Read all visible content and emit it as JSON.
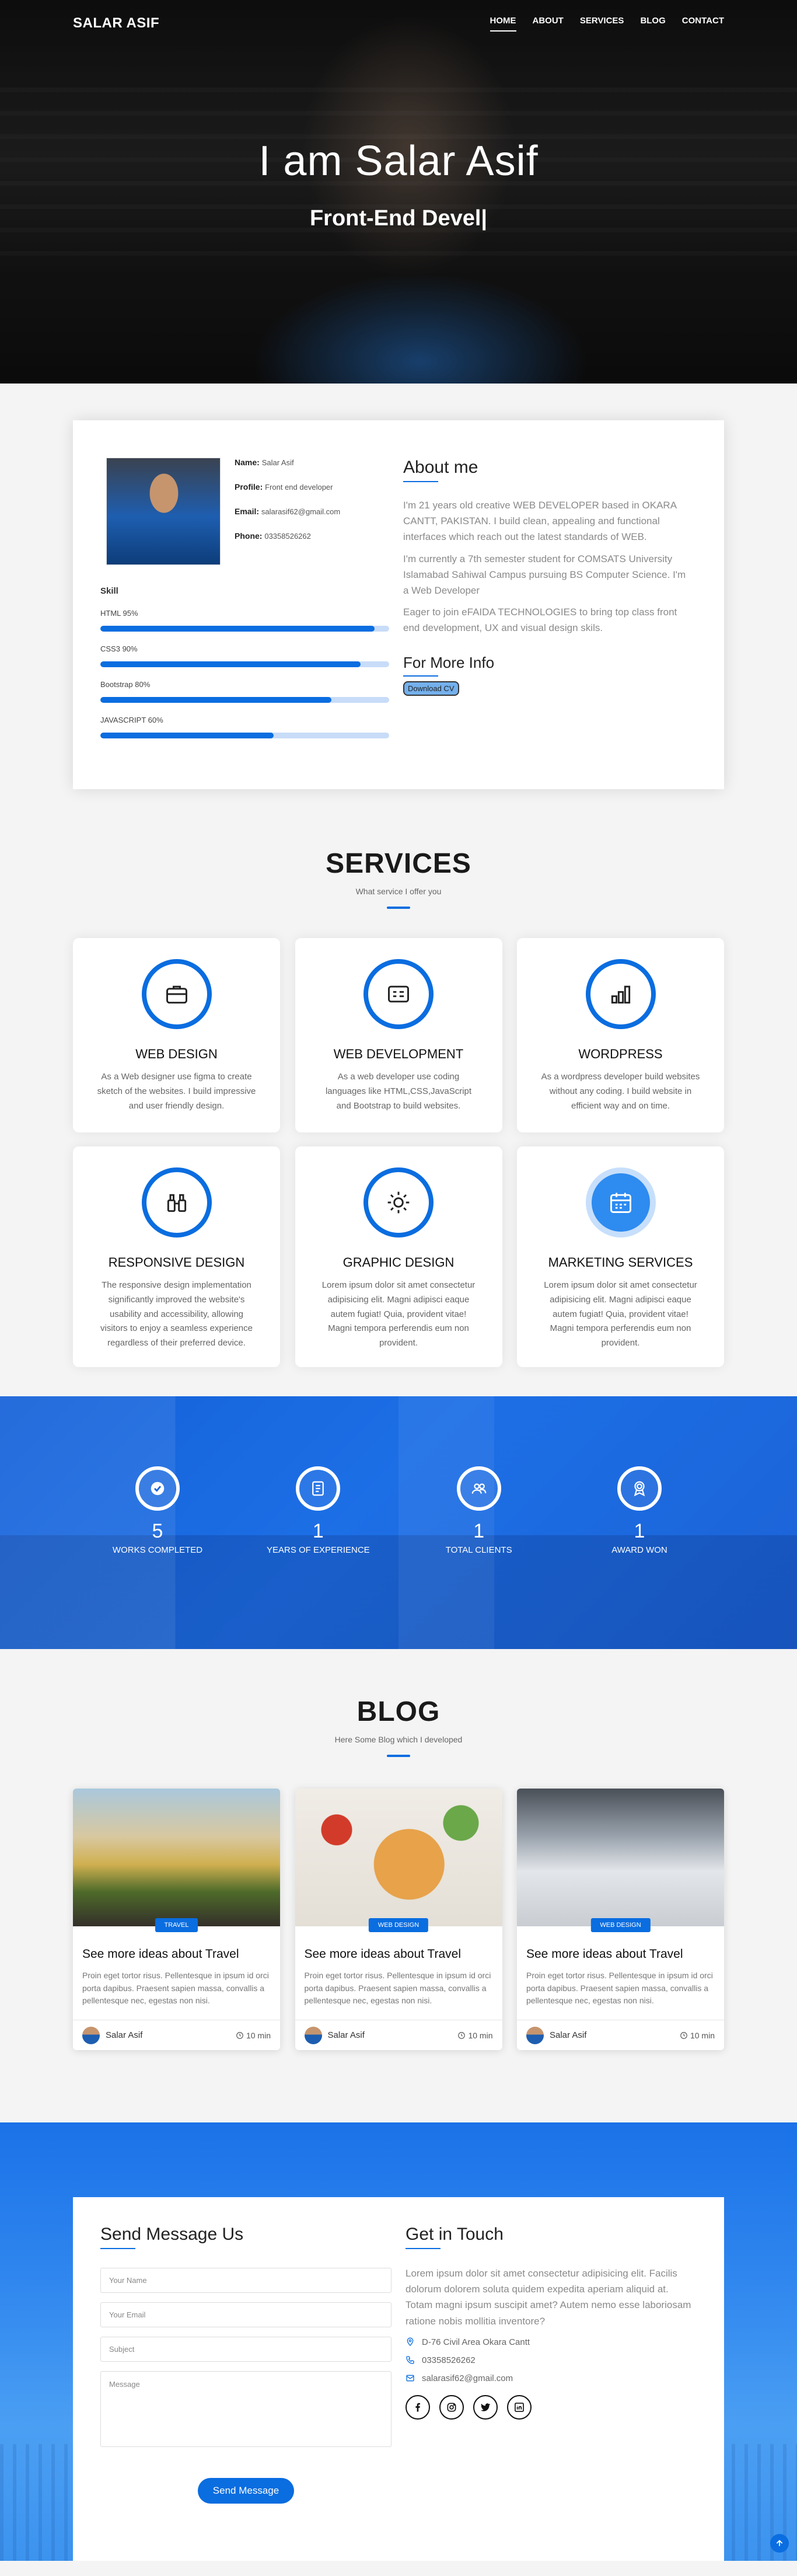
{
  "nav": {
    "logo": "SALAR ASIF",
    "items": [
      "HOME",
      "ABOUT",
      "SERVICES",
      "BLOG",
      "CONTACT"
    ]
  },
  "hero": {
    "title": "I am Salar Asif",
    "subtitle": "Front-End Devel|"
  },
  "about": {
    "name_label": "Name:",
    "name_value": "Salar Asif",
    "profile_label": "Profile:",
    "profile_value": "Front end developer",
    "email_label": "Email:",
    "email_value": "salarasif62@gmail.com",
    "phone_label": "Phone:",
    "phone_value": "03358526262",
    "skills_title": "Skill",
    "skills": [
      {
        "label": "HTML 95%",
        "percent": 95
      },
      {
        "label": "CSS3 90%",
        "percent": 90
      },
      {
        "label": "Bootstrap 80%",
        "percent": 80
      },
      {
        "label": "JAVASCRIPT 60%",
        "percent": 60
      }
    ],
    "heading": "About me",
    "p1": "I'm 21 years old creative WEB DEVELOPER based in OKARA CANTT, PAKISTAN. I build clean, appealing and functional interfaces which reach out the latest standards of WEB.",
    "p2": "I'm currently a 7th semester student for COMSATS University Islamabad Sahiwal Campus pursuing BS Computer Science. I'm a Web Developer",
    "p3": "Eager to join eFAIDA TECHNOLOGIES to bring top class front end development, UX and visual design skils.",
    "more_heading": "For More Info",
    "cv_button": "Download CV"
  },
  "services": {
    "title": "SERVICES",
    "subtitle": "What service I offer you",
    "items": [
      {
        "icon": "briefcase-icon",
        "title": "WEB DESIGN",
        "desc": "As a Web designer use figma to create sketch of the websites. I build impressive and user friendly design."
      },
      {
        "icon": "card-icon",
        "title": "WEB DEVELOPMENT",
        "desc": "As a web developer use coding languages like HTML,CSS,JavaScript and Bootstrap to build websites."
      },
      {
        "icon": "bar-chart-icon",
        "title": "WORDPRESS",
        "desc": "As a wordpress developer build websites without any coding. I build website in efficient way and on time."
      },
      {
        "icon": "binoculars-icon",
        "title": "RESPONSIVE DESIGN",
        "desc": "The responsive design implementation significantly improved the website's usability and accessibility, allowing visitors to enjoy a seamless experience regardless of their preferred device."
      },
      {
        "icon": "brightness-icon",
        "title": "GRAPHIC DESIGN",
        "desc": "Lorem ipsum dolor sit amet consectetur adipisicing elit. Magni adipisci eaque autem fugiat! Quia, provident vitae! Magni tempora perferendis eum non provident."
      },
      {
        "icon": "calendar-icon",
        "title": "MARKETING SERVICES",
        "desc": "Lorem ipsum dolor sit amet consectetur adipisicing elit. Magni adipisci eaque autem fugiat! Quia, provident vitae! Magni tempora perferendis eum non provident."
      }
    ]
  },
  "stats": [
    {
      "icon": "check-icon",
      "number": "5",
      "label": "WORKS COMPLETED"
    },
    {
      "icon": "journal-icon",
      "number": "1",
      "label": "YEARS OF EXPERIENCE"
    },
    {
      "icon": "people-icon",
      "number": "1",
      "label": "TOTAL CLIENTS"
    },
    {
      "icon": "award-icon",
      "number": "1",
      "label": "AWARD WON"
    }
  ],
  "blog": {
    "title": "BLOG",
    "subtitle": "Here Some Blog which I developed",
    "posts": [
      {
        "tag": "TRAVEL",
        "title": "See more ideas about Travel",
        "text": "Proin eget tortor risus. Pellentesque in ipsum id orci porta dapibus. Praesent sapien massa, convallis a pellentesque nec, egestas non nisi.",
        "author": "Salar Asif",
        "time": "10 min"
      },
      {
        "tag": "WEB DESIGN",
        "title": "See more ideas about Travel",
        "text": "Proin eget tortor risus. Pellentesque in ipsum id orci porta dapibus. Praesent sapien massa, convallis a pellentesque nec, egestas non nisi.",
        "author": "Salar Asif",
        "time": "10 min"
      },
      {
        "tag": "WEB DESIGN",
        "title": "See more ideas about Travel",
        "text": "Proin eget tortor risus. Pellentesque in ipsum id orci porta dapibus. Praesent sapien massa, convallis a pellentesque nec, egestas non nisi.",
        "author": "Salar Asif",
        "time": "10 min"
      }
    ]
  },
  "contact": {
    "form_heading": "Send Message Us",
    "name_placeholder": "Your Name",
    "email_placeholder": "Your Email",
    "subject_placeholder": "Subject",
    "message_placeholder": "Message",
    "send_button": "Send Message",
    "touch_heading": "Get in Touch",
    "touch_text": "Lorem ipsum dolor sit amet consectetur adipisicing elit. Facilis dolorum dolorem soluta quidem expedita aperiam aliquid at. Totam magni ipsum suscipit amet? Autem nemo esse laboriosam ratione nobis mollitia inventore?",
    "address": "D-76 Civil Area Okara Cantt",
    "phone": "03358526262",
    "email": "salarasif62@gmail.com"
  },
  "colors": {
    "accent": "#0a6de0",
    "dark": "#1a1a1a"
  }
}
